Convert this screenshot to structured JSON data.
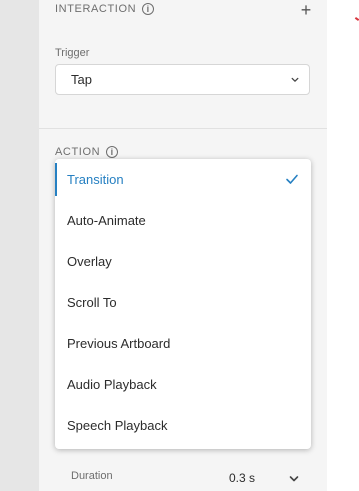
{
  "interaction": {
    "title": "INTERACTION",
    "info_icon": "info-icon",
    "add_icon": "plus-icon",
    "add_glyph": "+"
  },
  "trigger": {
    "label": "Trigger",
    "value": "Tap"
  },
  "action": {
    "title": "ACTION",
    "info_icon": "info-icon"
  },
  "dropdown": {
    "selected": "Transition",
    "items": [
      "Transition",
      "Auto-Animate",
      "Overlay",
      "Scroll To",
      "Previous Artboard",
      "Audio Playback",
      "Speech Playback"
    ]
  },
  "duration": {
    "label": "Duration",
    "value": "0.3 s"
  },
  "colors": {
    "accent": "#2680c2",
    "panel_bg": "#f5f5f5",
    "gutter_bg": "#e6e6e6"
  }
}
